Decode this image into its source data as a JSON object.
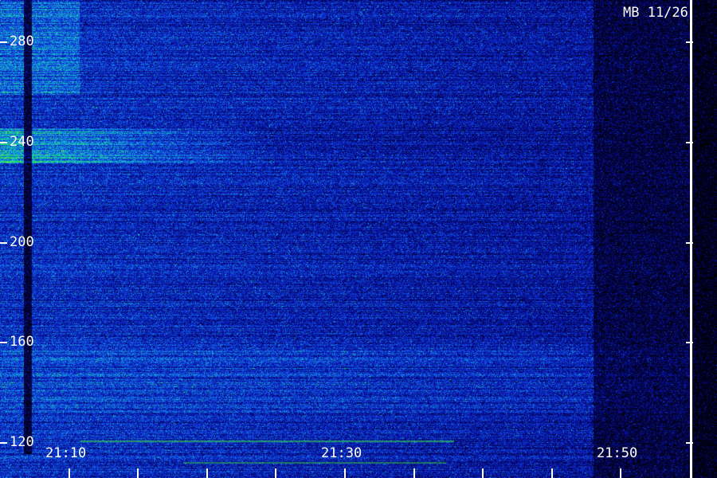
{
  "chart_data": {
    "type": "heatmap",
    "title": "",
    "annotation": "MB 11/26",
    "y_ticks": [
      "280",
      "240",
      "200",
      "160",
      "120"
    ],
    "y_tick_values": [
      280,
      240,
      200,
      160,
      120
    ],
    "ylim": [
      106,
      297
    ],
    "x_ticks": [
      "21:10",
      "21:30",
      "21:50"
    ],
    "x_tick_values": [
      "21:10",
      "21:30",
      "21:50"
    ],
    "x_minor_tick_interval_minutes": 5,
    "xlim": [
      "21:05",
      "21:55"
    ],
    "colormap": [
      "#000000",
      "#04045e",
      "#0a1cc0",
      "#1464e6",
      "#14c8c8",
      "#28f028",
      "#ffff00"
    ],
    "features": {
      "dark_vertical_band_at": "21:07",
      "signal_fades_after": "21:48",
      "bright_band_y": [
        232,
        246
      ],
      "bright_band_x": [
        "21:05",
        "21:25"
      ]
    }
  }
}
